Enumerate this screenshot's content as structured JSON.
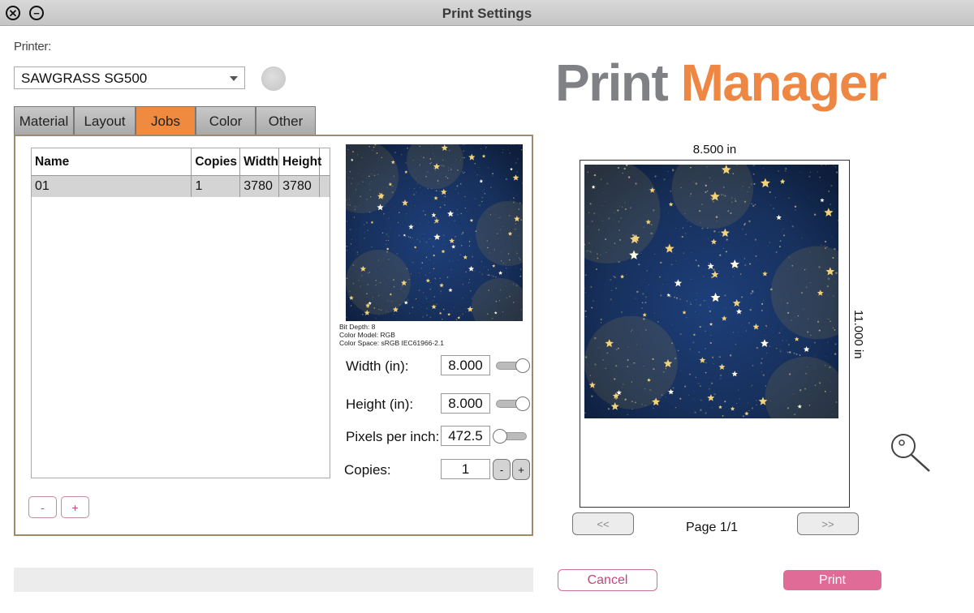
{
  "window": {
    "title": "Print Settings"
  },
  "printer": {
    "label": "Printer:",
    "selected": "SAWGRASS SG500"
  },
  "tabs": [
    {
      "label": "Material",
      "active": false
    },
    {
      "label": "Layout",
      "active": false
    },
    {
      "label": "Jobs",
      "active": true
    },
    {
      "label": "Color",
      "active": false
    },
    {
      "label": "Other",
      "active": false
    }
  ],
  "jobs_table": {
    "columns": [
      "Name",
      "Copies",
      "Width",
      "Height"
    ],
    "rows": [
      {
        "name": "01",
        "copies": "1",
        "width": "3780",
        "height": "3780"
      }
    ],
    "remove_label": "-",
    "add_label": "+"
  },
  "image_info": {
    "bit_depth": "Bit Depth: 8",
    "color_model": "Color Model: RGB",
    "color_space": "Color Space: sRGB IEC61966-2.1"
  },
  "fields": {
    "width": {
      "label": "Width (in):",
      "value": "8.000"
    },
    "height": {
      "label": "Height (in):",
      "value": "8.000"
    },
    "ppi": {
      "label": "Pixels per inch:",
      "value": "472.5"
    },
    "copies": {
      "label": "Copies:",
      "value": "1",
      "dec": "-",
      "inc": "+"
    }
  },
  "logo": {
    "part1": "Print",
    "part2": "Manager",
    "color1": "#808184",
    "color2": "#ee8743"
  },
  "preview": {
    "paper_width": "8.500 in",
    "paper_height": "11.000 in",
    "prev_label": "<<",
    "next_label": ">>",
    "page_label": "Page 1/1"
  },
  "actions": {
    "cancel": "Cancel",
    "print": "Print"
  },
  "colors": {
    "accent_tab": "#ef8a3e",
    "print_button": "#e06b96",
    "cancel_text": "#c2467a"
  }
}
